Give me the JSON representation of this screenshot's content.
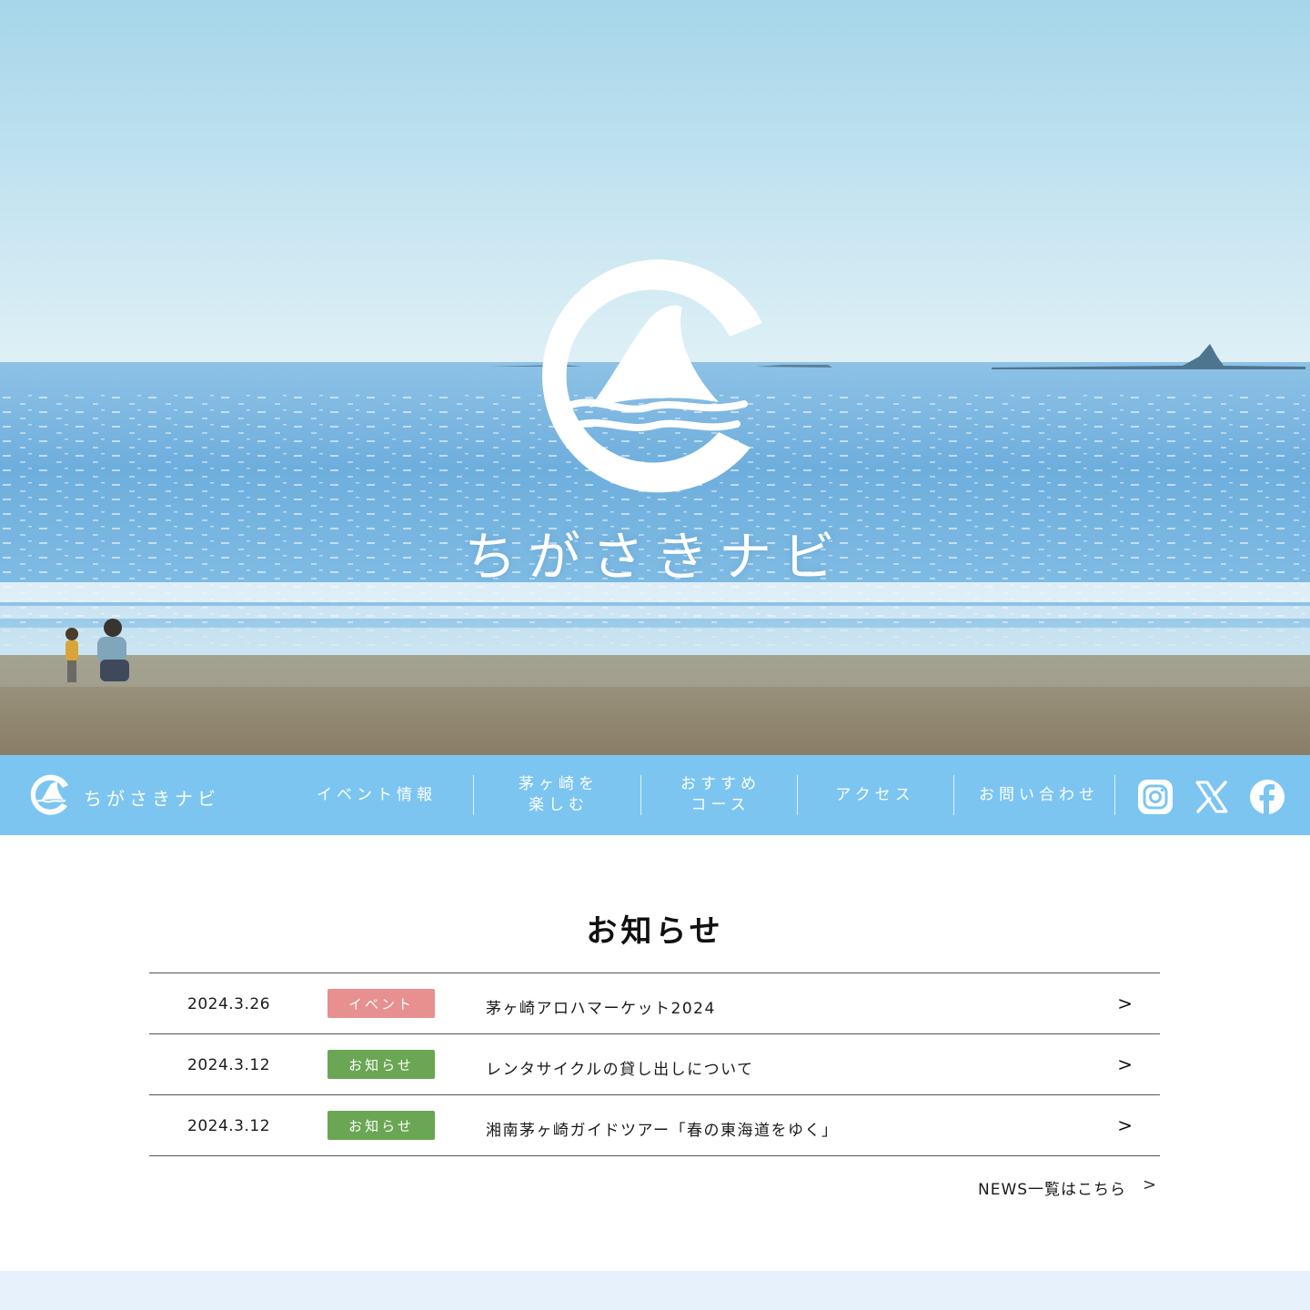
{
  "hero": {
    "title": "ちがさきナビ"
  },
  "nav": {
    "brand": "ちがさきナビ",
    "items": [
      {
        "label": "イベント情報"
      },
      {
        "label": "茅ヶ崎を\n楽しむ"
      },
      {
        "label": "おすすめ\nコース"
      },
      {
        "label": "アクセス"
      },
      {
        "label": "お問い合わせ"
      }
    ],
    "social": [
      "instagram-icon",
      "x-icon",
      "facebook-icon"
    ],
    "bg_color": "#7cc5f1"
  },
  "news": {
    "title": "お知らせ",
    "items": [
      {
        "date": "2024.3.26",
        "category": "イベント",
        "category_color": "#e88f8f",
        "text": "茅ヶ崎アロハマーケット2024"
      },
      {
        "date": "2024.3.12",
        "category": "お知らせ",
        "category_color": "#6aa653",
        "text": "レンタサイクルの貸し出しについて"
      },
      {
        "date": "2024.3.12",
        "category": "お知らせ",
        "category_color": "#6aa653",
        "text": "湘南茅ヶ崎ガイドツアー「春の東海道をゆく」"
      }
    ],
    "arrow": ">",
    "more_label": "NEWS一覧はこちら",
    "more_arrow": ">"
  }
}
